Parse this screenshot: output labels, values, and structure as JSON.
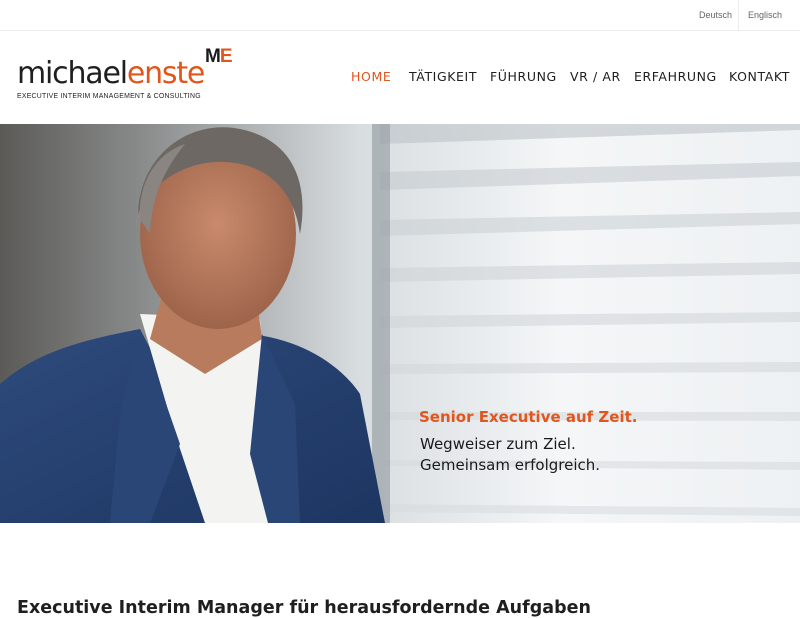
{
  "language_bar": {
    "items": [
      {
        "label": "Deutsch"
      },
      {
        "label": "Englisch"
      }
    ]
  },
  "logo": {
    "monogram_m": "M",
    "monogram_e": "E",
    "first_name": "michael",
    "last_name": "enste",
    "tagline": "EXECUTIVE INTERIM MANAGEMENT & CONSULTING"
  },
  "nav": {
    "items": [
      {
        "label": "HOME",
        "active": true
      },
      {
        "label": "TÄTIGKEIT",
        "active": false
      },
      {
        "label": "FÜHRUNG",
        "active": false
      },
      {
        "label": "VR / AR",
        "active": false
      },
      {
        "label": "ERFAHRUNG",
        "active": false
      },
      {
        "label": "KONTAKT",
        "active": false
      }
    ]
  },
  "hero": {
    "title": "Senior Executive auf Zeit.",
    "line1": "Wegweiser zum Ziel.",
    "line2": "Gemeinsam erfolgreich."
  },
  "intro": {
    "bold": "Executive Interim Manager",
    "rest": " für herausfordernde Aufgaben"
  },
  "colors": {
    "accent": "#e0561d",
    "text": "#1f1f1f"
  }
}
